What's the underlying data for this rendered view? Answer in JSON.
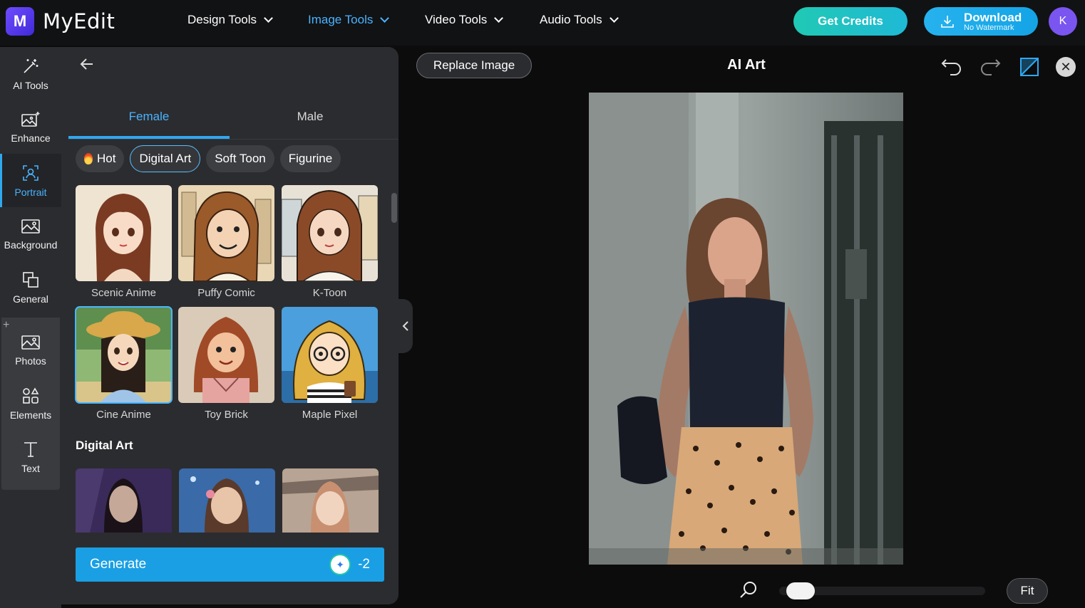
{
  "app": {
    "logo_letter": "M",
    "name": "MyEdit"
  },
  "nav": [
    {
      "label": "Design Tools"
    },
    {
      "label": "Image Tools",
      "active": true
    },
    {
      "label": "Video Tools"
    },
    {
      "label": "Audio Tools"
    }
  ],
  "header": {
    "get_credits": "Get Credits",
    "download_title": "Download",
    "download_sub": "No Watermark",
    "avatar_initial": "K"
  },
  "rail": {
    "items": [
      {
        "label": "AI Tools",
        "icon": "magic-wand-icon"
      },
      {
        "label": "Enhance",
        "icon": "image-sparkle-icon"
      },
      {
        "label": "Portrait",
        "icon": "portrait-icon",
        "active": true
      },
      {
        "label": "Background",
        "icon": "background-icon"
      },
      {
        "label": "General",
        "icon": "copy-icon"
      },
      {
        "label": "Photos",
        "icon": "photo-icon"
      },
      {
        "label": "Elements",
        "icon": "shapes-icon"
      },
      {
        "label": "Text",
        "icon": "text-icon"
      }
    ],
    "plus": "+"
  },
  "panel": {
    "tabs": [
      "Female",
      "Male"
    ],
    "chips": [
      "Hot",
      "Digital Art",
      "Soft Toon",
      "Figurine"
    ],
    "styles": [
      "Scenic Anime",
      "Puffy Comic",
      "K-Toon",
      "Cine Anime",
      "Toy Brick",
      "Maple Pixel"
    ],
    "section_title": "Digital Art",
    "generate_label": "Generate",
    "generate_cost": "-2"
  },
  "canvas": {
    "replace_label": "Replace Image",
    "title": "AI Art",
    "fit_label": "Fit",
    "zoom_level": 0.05
  },
  "colors": {
    "accent": "#2fa8f0",
    "teal": "#20c9b4",
    "avatar": "#7a55f0"
  }
}
